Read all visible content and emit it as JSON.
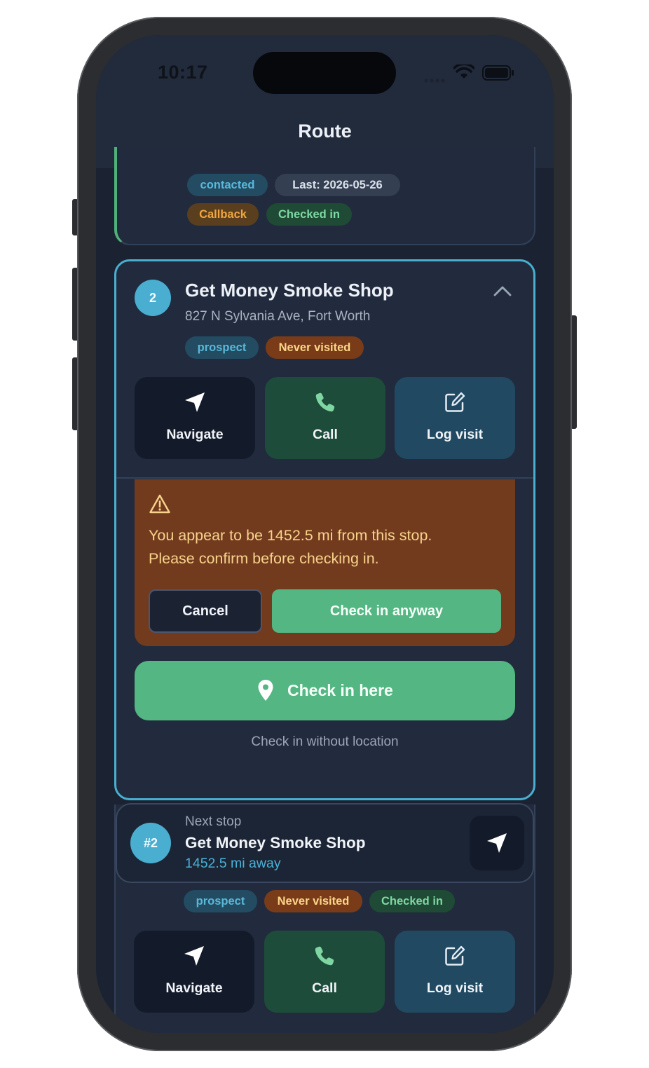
{
  "status_bar": {
    "time": "10:17"
  },
  "header": {
    "title": "Route"
  },
  "stop_prev": {
    "tags": [
      "contacted",
      "Last: 2026-05-26",
      "Callback",
      "Checked in"
    ]
  },
  "stop": {
    "number": "2",
    "name": "Get Money Smoke Shop",
    "address": "827 N Sylvania Ave, Fort Worth",
    "tags": [
      "prospect",
      "Never visited"
    ],
    "actions": {
      "navigate": "Navigate",
      "call": "Call",
      "log_visit": "Log visit"
    },
    "warning": {
      "message": "You appear to be 1452.5 mi from this stop. Please confirm before checking in.",
      "cancel": "Cancel",
      "confirm": "Check in anyway"
    },
    "check_in": "Check in here",
    "check_in_no_location": "Check in without location"
  },
  "next_stop": {
    "badge": "#2",
    "label": "Next stop",
    "name": "Get Money Smoke Shop",
    "distance": "1452.5 mi away",
    "tags": [
      "prospect",
      "Never visited",
      "Checked in"
    ],
    "actions": {
      "navigate": "Navigate",
      "call": "Call",
      "log_visit": "Log visit"
    }
  },
  "colors": {
    "background": "#1b2332",
    "card": "#212b3d",
    "accent_blue": "#4aaed0",
    "accent_green": "#53b683",
    "warning_bg": "#733b1d",
    "warning_text": "#f7d38c"
  },
  "icons": [
    "navigation-arrow-icon",
    "phone-icon",
    "edit-icon",
    "warning-icon",
    "map-pin-icon",
    "chevron-up-icon",
    "wifi-icon",
    "battery-icon",
    "signal-icon"
  ]
}
